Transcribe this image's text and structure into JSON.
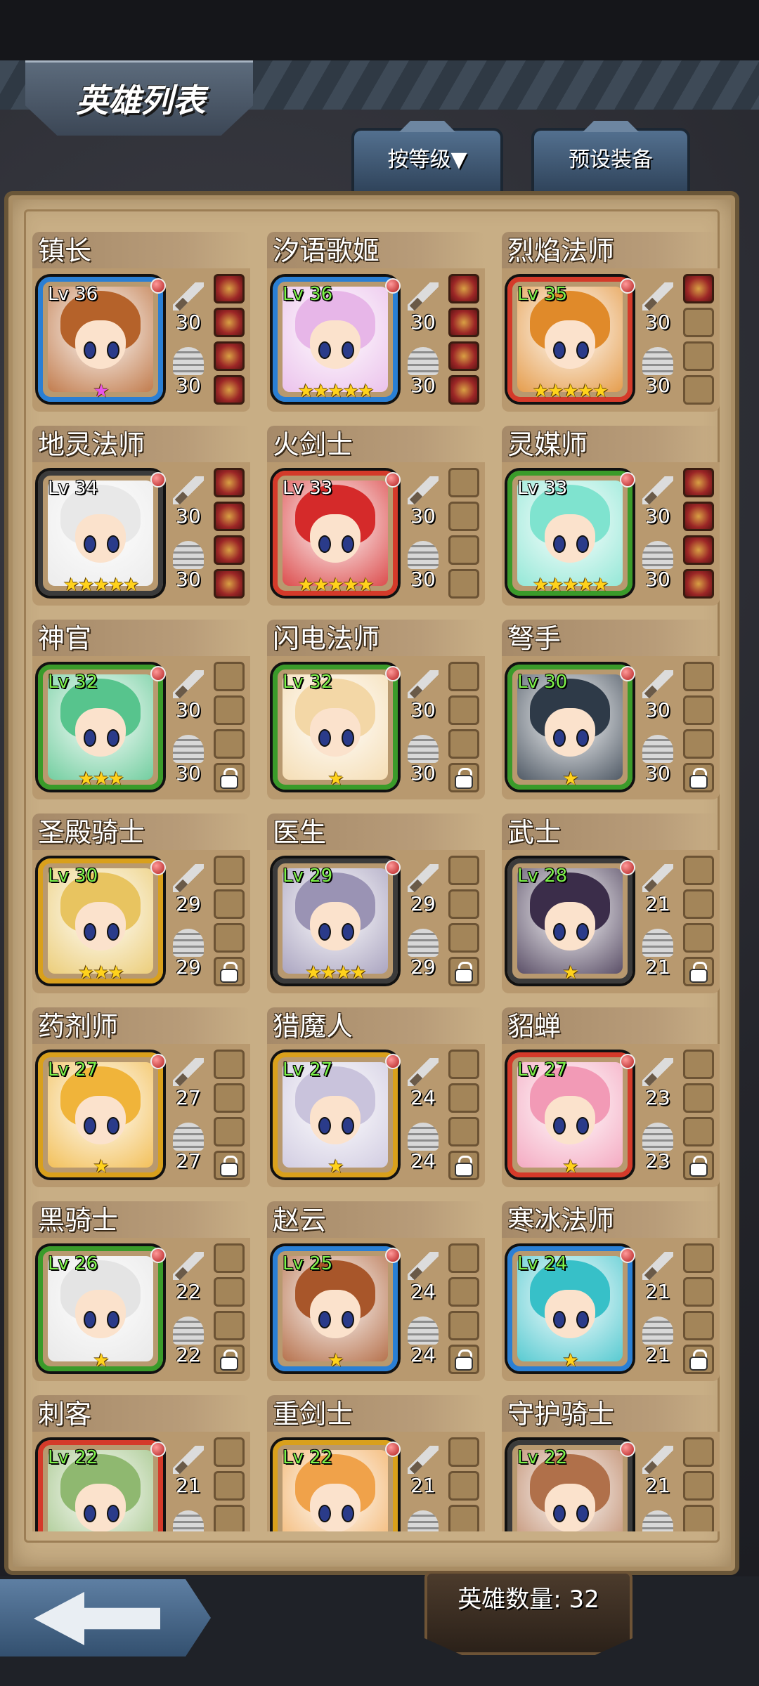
{
  "header": {
    "title": "英雄列表",
    "sort_button": "按等级▼",
    "preset_button": "预设装备"
  },
  "footer": {
    "hero_count_label": "英雄数量: 32"
  },
  "heroes": [
    {
      "name": "镇长",
      "level": "Lv 36",
      "atk": "30",
      "def": "30",
      "stars": "★",
      "star_color": "pink",
      "level_color": "white",
      "hair": "#b5622a",
      "frame": "#2a7fd4",
      "slots": [
        "filled",
        "filled",
        "filled",
        "filled"
      ]
    },
    {
      "name": "汐语歌姬",
      "level": "Lv 36",
      "atk": "30",
      "def": "30",
      "stars": "★★★★★",
      "star_color": "gold",
      "level_color": "green",
      "hair": "#e7b6e8",
      "frame": "#2a7fd4",
      "slots": [
        "filled",
        "filled",
        "filled",
        "filled"
      ]
    },
    {
      "name": "烈焰法师",
      "level": "Lv 35",
      "atk": "30",
      "def": "30",
      "stars": "★★★★★",
      "star_color": "gold",
      "level_color": "green",
      "hair": "#e08a2a",
      "frame": "#d43a2a",
      "slots": [
        "filled",
        "empty",
        "empty",
        "empty"
      ]
    },
    {
      "name": "地灵法师",
      "level": "Lv 34",
      "atk": "30",
      "def": "30",
      "stars": "★★★★★",
      "star_color": "gold",
      "level_color": "white",
      "hair": "#e8e8e8",
      "frame": "#3b3b3b",
      "slots": [
        "filled",
        "filled",
        "filled",
        "filled"
      ]
    },
    {
      "name": "火剑士",
      "level": "Lv 33",
      "atk": "30",
      "def": "30",
      "stars": "★★★★★",
      "star_color": "gold",
      "level_color": "white",
      "hair": "#d52a2a",
      "frame": "#d43a2a",
      "slots": [
        "empty",
        "empty",
        "empty",
        "empty"
      ]
    },
    {
      "name": "灵媒师",
      "level": "Lv 33",
      "atk": "30",
      "def": "30",
      "stars": "★★★★★",
      "star_color": "gold",
      "level_color": "white",
      "hair": "#7fe3cf",
      "frame": "#3a9b2a",
      "slots": [
        "filled",
        "filled",
        "filled",
        "filled"
      ]
    },
    {
      "name": "神官",
      "level": "Lv 32",
      "atk": "30",
      "def": "30",
      "stars": "★★★",
      "star_color": "gold",
      "level_color": "green",
      "hair": "#57c48d",
      "frame": "#3a9b2a",
      "slots": [
        "empty",
        "empty",
        "empty",
        "lock"
      ]
    },
    {
      "name": "闪电法师",
      "level": "Lv 32",
      "atk": "30",
      "def": "30",
      "stars": "★",
      "star_color": "gold",
      "level_color": "green",
      "hair": "#f3d7a6",
      "frame": "#3a9b2a",
      "slots": [
        "empty",
        "empty",
        "empty",
        "lock"
      ]
    },
    {
      "name": "弩手",
      "level": "Lv 30",
      "atk": "30",
      "def": "30",
      "stars": "★",
      "star_color": "gold",
      "level_color": "green",
      "hair": "#2e3a48",
      "frame": "#3a9b2a",
      "slots": [
        "empty",
        "empty",
        "empty",
        "lock"
      ]
    },
    {
      "name": "圣殿骑士",
      "level": "Lv 30",
      "atk": "29",
      "def": "29",
      "stars": "★★★",
      "star_color": "gold",
      "level_color": "green",
      "hair": "#e8c460",
      "frame": "#d9a01c",
      "slots": [
        "empty",
        "empty",
        "empty",
        "lock"
      ]
    },
    {
      "name": "医生",
      "level": "Lv 29",
      "atk": "29",
      "def": "29",
      "stars": "★★★★",
      "star_color": "gold",
      "level_color": "green",
      "hair": "#9a93b4",
      "frame": "#3b3b3b",
      "slots": [
        "empty",
        "empty",
        "empty",
        "lock"
      ]
    },
    {
      "name": "武士",
      "level": "Lv 28",
      "atk": "21",
      "def": "21",
      "stars": "★",
      "star_color": "gold",
      "level_color": "green",
      "hair": "#3b2d4a",
      "frame": "#3b3b3b",
      "slots": [
        "empty",
        "empty",
        "empty",
        "lock"
      ]
    },
    {
      "name": "药剂师",
      "level": "Lv 27",
      "atk": "27",
      "def": "27",
      "stars": "★",
      "star_color": "gold",
      "level_color": "green",
      "hair": "#f0b43a",
      "frame": "#d9a01c",
      "slots": [
        "empty",
        "empty",
        "empty",
        "lock"
      ]
    },
    {
      "name": "猎魔人",
      "level": "Lv 27",
      "atk": "24",
      "def": "24",
      "stars": "★",
      "star_color": "gold",
      "level_color": "green",
      "hair": "#c9c3dc",
      "frame": "#d9a01c",
      "slots": [
        "empty",
        "empty",
        "empty",
        "lock"
      ]
    },
    {
      "name": "貂蝉",
      "level": "Lv 27",
      "atk": "23",
      "def": "23",
      "stars": "★",
      "star_color": "gold",
      "level_color": "green",
      "hair": "#f29ab6",
      "frame": "#d43a2a",
      "slots": [
        "empty",
        "empty",
        "empty",
        "lock"
      ]
    },
    {
      "name": "黑骑士",
      "level": "Lv 26",
      "atk": "22",
      "def": "22",
      "stars": "★",
      "star_color": "gold",
      "level_color": "green",
      "hair": "#e4e4e4",
      "frame": "#3a9b2a",
      "slots": [
        "empty",
        "empty",
        "empty",
        "lock"
      ]
    },
    {
      "name": "赵云",
      "level": "Lv 25",
      "atk": "24",
      "def": "24",
      "stars": "★",
      "star_color": "gold",
      "level_color": "green",
      "hair": "#a8562a",
      "frame": "#2a7fd4",
      "slots": [
        "empty",
        "empty",
        "empty",
        "lock"
      ]
    },
    {
      "name": "寒冰法师",
      "level": "Lv 24",
      "atk": "21",
      "def": "21",
      "stars": "★",
      "star_color": "gold",
      "level_color": "green",
      "hair": "#37c0c8",
      "frame": "#2a7fd4",
      "slots": [
        "empty",
        "empty",
        "empty",
        "lock"
      ]
    },
    {
      "name": "刺客",
      "level": "Lv 22",
      "atk": "21",
      "def": "",
      "stars": "",
      "star_color": "gold",
      "level_color": "green",
      "hair": "#8fb870",
      "frame": "#d43a2a",
      "slots": [
        "empty",
        "empty",
        "empty",
        "empty"
      ]
    },
    {
      "name": "重剑士",
      "level": "Lv 22",
      "atk": "21",
      "def": "",
      "stars": "",
      "star_color": "gold",
      "level_color": "green",
      "hair": "#f0a24a",
      "frame": "#d9a01c",
      "slots": [
        "empty",
        "empty",
        "empty",
        "empty"
      ]
    },
    {
      "name": "守护骑士",
      "level": "Lv 22",
      "atk": "21",
      "def": "",
      "stars": "",
      "star_color": "gold",
      "level_color": "green",
      "hair": "#b0704a",
      "frame": "#3b3b3b",
      "slots": [
        "empty",
        "empty",
        "empty",
        "empty"
      ]
    }
  ]
}
